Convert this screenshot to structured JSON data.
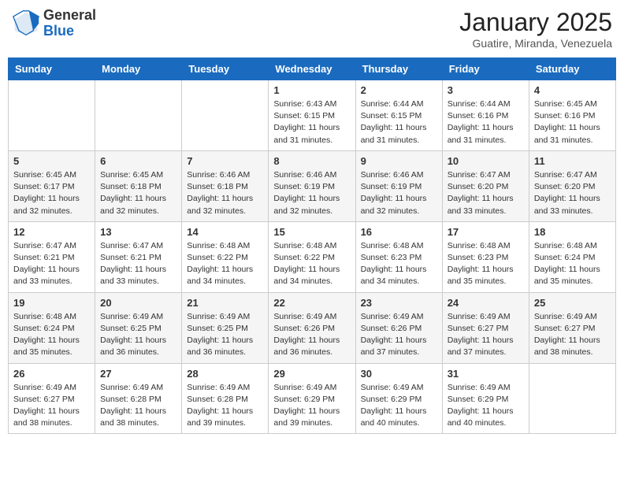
{
  "header": {
    "logo_general": "General",
    "logo_blue": "Blue",
    "title": "January 2025",
    "subtitle": "Guatire, Miranda, Venezuela"
  },
  "weekdays": [
    "Sunday",
    "Monday",
    "Tuesday",
    "Wednesday",
    "Thursday",
    "Friday",
    "Saturday"
  ],
  "weeks": [
    [
      {
        "day": "",
        "sunrise": "",
        "sunset": "",
        "daylight": ""
      },
      {
        "day": "",
        "sunrise": "",
        "sunset": "",
        "daylight": ""
      },
      {
        "day": "",
        "sunrise": "",
        "sunset": "",
        "daylight": ""
      },
      {
        "day": "1",
        "sunrise": "Sunrise: 6:43 AM",
        "sunset": "Sunset: 6:15 PM",
        "daylight": "Daylight: 11 hours and 31 minutes."
      },
      {
        "day": "2",
        "sunrise": "Sunrise: 6:44 AM",
        "sunset": "Sunset: 6:15 PM",
        "daylight": "Daylight: 11 hours and 31 minutes."
      },
      {
        "day": "3",
        "sunrise": "Sunrise: 6:44 AM",
        "sunset": "Sunset: 6:16 PM",
        "daylight": "Daylight: 11 hours and 31 minutes."
      },
      {
        "day": "4",
        "sunrise": "Sunrise: 6:45 AM",
        "sunset": "Sunset: 6:16 PM",
        "daylight": "Daylight: 11 hours and 31 minutes."
      }
    ],
    [
      {
        "day": "5",
        "sunrise": "Sunrise: 6:45 AM",
        "sunset": "Sunset: 6:17 PM",
        "daylight": "Daylight: 11 hours and 32 minutes."
      },
      {
        "day": "6",
        "sunrise": "Sunrise: 6:45 AM",
        "sunset": "Sunset: 6:18 PM",
        "daylight": "Daylight: 11 hours and 32 minutes."
      },
      {
        "day": "7",
        "sunrise": "Sunrise: 6:46 AM",
        "sunset": "Sunset: 6:18 PM",
        "daylight": "Daylight: 11 hours and 32 minutes."
      },
      {
        "day": "8",
        "sunrise": "Sunrise: 6:46 AM",
        "sunset": "Sunset: 6:19 PM",
        "daylight": "Daylight: 11 hours and 32 minutes."
      },
      {
        "day": "9",
        "sunrise": "Sunrise: 6:46 AM",
        "sunset": "Sunset: 6:19 PM",
        "daylight": "Daylight: 11 hours and 32 minutes."
      },
      {
        "day": "10",
        "sunrise": "Sunrise: 6:47 AM",
        "sunset": "Sunset: 6:20 PM",
        "daylight": "Daylight: 11 hours and 33 minutes."
      },
      {
        "day": "11",
        "sunrise": "Sunrise: 6:47 AM",
        "sunset": "Sunset: 6:20 PM",
        "daylight": "Daylight: 11 hours and 33 minutes."
      }
    ],
    [
      {
        "day": "12",
        "sunrise": "Sunrise: 6:47 AM",
        "sunset": "Sunset: 6:21 PM",
        "daylight": "Daylight: 11 hours and 33 minutes."
      },
      {
        "day": "13",
        "sunrise": "Sunrise: 6:47 AM",
        "sunset": "Sunset: 6:21 PM",
        "daylight": "Daylight: 11 hours and 33 minutes."
      },
      {
        "day": "14",
        "sunrise": "Sunrise: 6:48 AM",
        "sunset": "Sunset: 6:22 PM",
        "daylight": "Daylight: 11 hours and 34 minutes."
      },
      {
        "day": "15",
        "sunrise": "Sunrise: 6:48 AM",
        "sunset": "Sunset: 6:22 PM",
        "daylight": "Daylight: 11 hours and 34 minutes."
      },
      {
        "day": "16",
        "sunrise": "Sunrise: 6:48 AM",
        "sunset": "Sunset: 6:23 PM",
        "daylight": "Daylight: 11 hours and 34 minutes."
      },
      {
        "day": "17",
        "sunrise": "Sunrise: 6:48 AM",
        "sunset": "Sunset: 6:23 PM",
        "daylight": "Daylight: 11 hours and 35 minutes."
      },
      {
        "day": "18",
        "sunrise": "Sunrise: 6:48 AM",
        "sunset": "Sunset: 6:24 PM",
        "daylight": "Daylight: 11 hours and 35 minutes."
      }
    ],
    [
      {
        "day": "19",
        "sunrise": "Sunrise: 6:48 AM",
        "sunset": "Sunset: 6:24 PM",
        "daylight": "Daylight: 11 hours and 35 minutes."
      },
      {
        "day": "20",
        "sunrise": "Sunrise: 6:49 AM",
        "sunset": "Sunset: 6:25 PM",
        "daylight": "Daylight: 11 hours and 36 minutes."
      },
      {
        "day": "21",
        "sunrise": "Sunrise: 6:49 AM",
        "sunset": "Sunset: 6:25 PM",
        "daylight": "Daylight: 11 hours and 36 minutes."
      },
      {
        "day": "22",
        "sunrise": "Sunrise: 6:49 AM",
        "sunset": "Sunset: 6:26 PM",
        "daylight": "Daylight: 11 hours and 36 minutes."
      },
      {
        "day": "23",
        "sunrise": "Sunrise: 6:49 AM",
        "sunset": "Sunset: 6:26 PM",
        "daylight": "Daylight: 11 hours and 37 minutes."
      },
      {
        "day": "24",
        "sunrise": "Sunrise: 6:49 AM",
        "sunset": "Sunset: 6:27 PM",
        "daylight": "Daylight: 11 hours and 37 minutes."
      },
      {
        "day": "25",
        "sunrise": "Sunrise: 6:49 AM",
        "sunset": "Sunset: 6:27 PM",
        "daylight": "Daylight: 11 hours and 38 minutes."
      }
    ],
    [
      {
        "day": "26",
        "sunrise": "Sunrise: 6:49 AM",
        "sunset": "Sunset: 6:27 PM",
        "daylight": "Daylight: 11 hours and 38 minutes."
      },
      {
        "day": "27",
        "sunrise": "Sunrise: 6:49 AM",
        "sunset": "Sunset: 6:28 PM",
        "daylight": "Daylight: 11 hours and 38 minutes."
      },
      {
        "day": "28",
        "sunrise": "Sunrise: 6:49 AM",
        "sunset": "Sunset: 6:28 PM",
        "daylight": "Daylight: 11 hours and 39 minutes."
      },
      {
        "day": "29",
        "sunrise": "Sunrise: 6:49 AM",
        "sunset": "Sunset: 6:29 PM",
        "daylight": "Daylight: 11 hours and 39 minutes."
      },
      {
        "day": "30",
        "sunrise": "Sunrise: 6:49 AM",
        "sunset": "Sunset: 6:29 PM",
        "daylight": "Daylight: 11 hours and 40 minutes."
      },
      {
        "day": "31",
        "sunrise": "Sunrise: 6:49 AM",
        "sunset": "Sunset: 6:29 PM",
        "daylight": "Daylight: 11 hours and 40 minutes."
      },
      {
        "day": "",
        "sunrise": "",
        "sunset": "",
        "daylight": ""
      }
    ]
  ]
}
